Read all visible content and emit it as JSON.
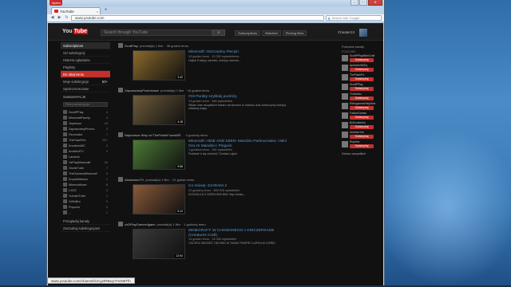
{
  "browser": {
    "menu_label": "Opera",
    "tab_title": "YouTube",
    "tab_close": "×",
    "new_tab": "+",
    "url_prefix": "",
    "url": "www.youtube.com",
    "search_placeholder": "Search with Google",
    "status_url": "www.youtube.com/channel/UCgi4RBwy7HcM6Tfn"
  },
  "youtube": {
    "logo_you": "You",
    "logo_tube": "Tube",
    "search_placeholder": "Search through YouTube",
    "search_button": "⌕",
    "tabs": [
      "Subscriptions",
      "Watched",
      "Pinning films"
    ],
    "username": "Cheater13"
  },
  "sidebar": {
    "items": [
      {
        "label": "Subscriptions",
        "active": true
      },
      {
        "label": "Od subskrypcji"
      },
      {
        "label": "Historia ogladania"
      },
      {
        "label": "Playlisty"
      }
    ],
    "watch_later": {
      "label": "Do obejrzenia",
      "count": ""
    },
    "liked": {
      "label": "Moje subskrypcje",
      "count": "50+"
    },
    "all": {
      "label": "Spolecznosciowe",
      "count": ""
    },
    "subs_title": "SUBSKRYPCJE",
    "filter_placeholder": "Filtruj subskrypcje",
    "subs": [
      {
        "name": "ScottPPlay",
        "count": "4"
      },
      {
        "name": "MinecraftFamily",
        "count": "4"
      },
      {
        "name": "Jeyanosz",
        "count": "18"
      },
      {
        "name": "ZapraszamyPrzem...",
        "count": "3"
      },
      {
        "name": "Rezonator",
        "count": "7"
      },
      {
        "name": "TheFakeFire",
        "count": "50+"
      },
      {
        "name": "KrzakersMC",
        "count": "4"
      },
      {
        "name": "AmbientTV",
        "count": "9"
      },
      {
        "name": "Lanarek",
        "count": ""
      },
      {
        "name": "YaPlayMinecraft",
        "count": "34"
      },
      {
        "name": "GizzieTube",
        "count": "7"
      },
      {
        "name": "TheGamersMinecraft",
        "count": "3"
      },
      {
        "name": "KrzysMateusz",
        "count": "1"
      },
      {
        "name": "Minecraftowe",
        "count": "8"
      },
      {
        "name": "LJDG",
        "count": "4"
      },
      {
        "name": "YumsieTube",
        "count": "1"
      },
      {
        "name": "GrBoBro",
        "count": "9"
      },
      {
        "name": "Popcorn",
        "count": "2"
      },
      {
        "name": "...",
        "count": "1"
      }
    ],
    "bottom": [
      "Przegladaj kanaly",
      "Zarzadzaj subskrypcjami"
    ]
  },
  "feed": [
    {
      "channel": "ScottPlay",
      "action": "przesłał(a) 1 film",
      "time": "· 36 godzin temu",
      "title": "Minecraft: Oszczędny Piecyk!",
      "meta": "13 godzin temu · 10 332 wyświetlenia",
      "desc": "Hejka! Kolejny odcinek, kolejny odcinek...",
      "duration": "3:42",
      "thumb_color": "#8a6a2a"
    },
    {
      "channel": "ZapraszamyPrzemkowe",
      "action": "przesłał(a) 1 film",
      "time": "· 16 godzin temu",
      "title": "#19 Punkty szybkiej podróży",
      "meta": "13 godzin temu · 564 wyświetleń",
      "desc": "Witam was wszystkich bardzo serdecznie w odcinku dziś zobaczymy kolejną ciekawą mapę",
      "duration": "4:18",
      "thumb_color": "#6d5a3a"
    },
    {
      "channel": "Najnowsze filmy od ThePolishFoxesMR",
      "action": "",
      "time": "· 4 godziny temu",
      "title": "Minecraft: HIDE AND SEEK! Mandzio Parkourowiec i Mini Gra ze Mandzio i Pingwin",
      "meta": "1 godzina temu · 261 wyświetleń",
      "desc": "Podobał ci się odcinek? Zostaw Lajka!",
      "duration": "9:56",
      "thumb_color": "#4c7a36"
    },
    {
      "channel": "AbstrackerTV",
      "action": "przesłał(a) 1 film",
      "time": "· 21 godzin temu",
      "title": "Co mówię: ZJARANI 2",
      "meta": "22 godziny temu · 465 926 wyświetleń",
      "desc": "KOSZULKA Z SERDUSZKIEM: http://sklep...",
      "duration": "5:12",
      "thumb_color": "#8a5a3a"
    },
    {
      "channel": "xxDPlayGames4gaim",
      "action": "przesłał(a) 1 film",
      "time": "· 1 godzinę temu",
      "title": "MINECRAFT: W CHOWANEGO z KRICZERSAMI! (Creatures Craft)",
      "meta": "13 godzin temu · 15 330 wyświetleń",
      "desc": "CHCESZ WIDZIEĆ ODCINKI W TAKIM TEMPIE? ŁAPKA W GÓRĘ!",
      "duration": "12:04",
      "thumb_color": "#3a3a3a"
    }
  ],
  "right": {
    "title": "Polecane kanały",
    "subtitle": "POLECANE",
    "subscribe_label": "Subskrybuj",
    "channels": [
      "ScottPPlayMineCraft",
      "ApidobuNiDDy",
      "TheFlashPo",
      "ScottPPlay",
      "Trolsotsiu",
      "RetrogamesPlayMine",
      "FalloutGames",
      "ByScottchelo",
      "AmbitonYou",
      "Rupelec"
    ],
    "more": "Zobacz wszystkich"
  }
}
